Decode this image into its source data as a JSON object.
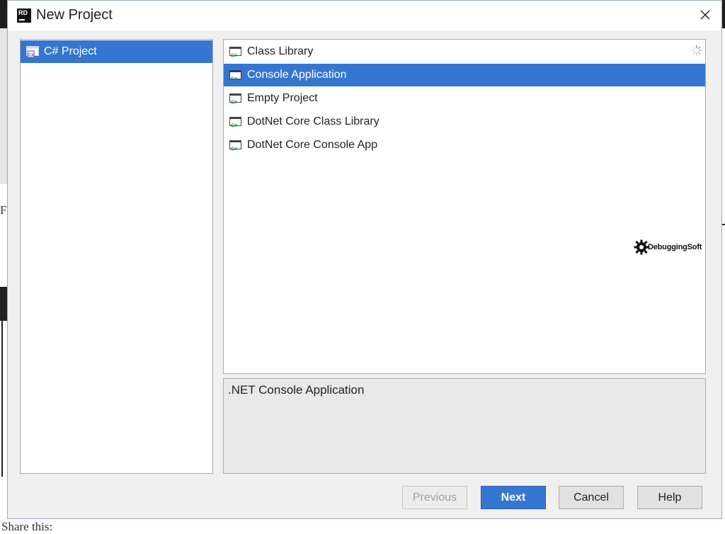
{
  "background": {
    "partial_char": "F",
    "footer_text": "Share this:"
  },
  "dialog": {
    "app_logo": "RD",
    "title": "New Project",
    "close_icon": "close-icon"
  },
  "categories": [
    {
      "label": "C# Project",
      "icon": "csharp-project-icon",
      "selected": true
    }
  ],
  "templates": [
    {
      "label": "Class Library",
      "icon": "csharp-template-icon",
      "selected": false
    },
    {
      "label": "Console Application",
      "icon": "csharp-template-icon",
      "selected": true
    },
    {
      "label": "Empty Project",
      "icon": "csharp-template-icon",
      "selected": false
    },
    {
      "label": "DotNet Core Class Library",
      "icon": "csharp-template-icon",
      "selected": false
    },
    {
      "label": "DotNet Core Console App",
      "icon": "csharp-template-icon",
      "selected": false
    }
  ],
  "description": ".NET Console Application",
  "watermark": "DebuggingSoft",
  "buttons": {
    "previous": "Previous",
    "next": "Next",
    "cancel": "Cancel",
    "help": "Help"
  },
  "colors": {
    "selection": "#3576d0",
    "dialog_bg": "#f0f0f0",
    "icon_green": "#2f8f3a"
  }
}
